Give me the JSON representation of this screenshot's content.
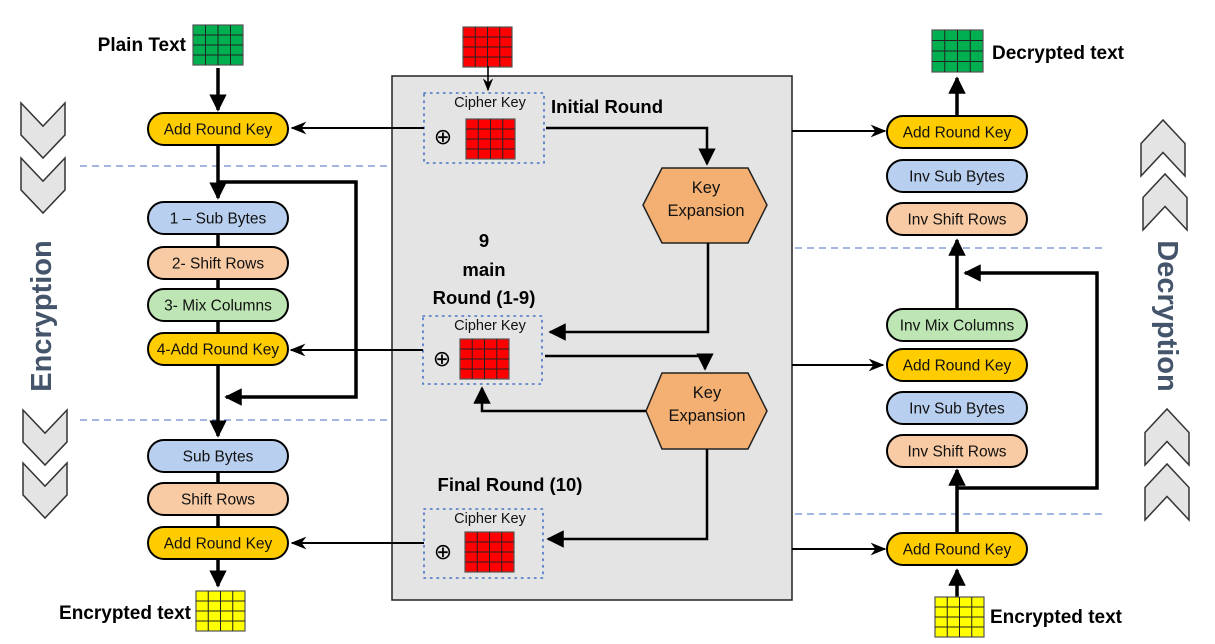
{
  "colors": {
    "yellow_pill": "#ffcc00",
    "blue_pill": "#b8cfef",
    "peach_pill": "#f8cba4",
    "green_pill": "#bde6b4",
    "key_expansion": "#f4b072",
    "round_panel": "#e4e4e4",
    "plain_block": "#00b050",
    "key_block": "#ff0000",
    "cipher_block": "#ffff00",
    "side_label": "#44546a",
    "divider": "#4472c4"
  },
  "side_labels": {
    "encryption": "Encryption",
    "decryption": "Decryption"
  },
  "encryption": {
    "input_label": "Plain Text",
    "output_label": "Encrypted text",
    "initial": {
      "add_round_key": "Add Round Key"
    },
    "main_steps": [
      "1 – Sub Bytes",
      "2- Shift Rows",
      "3- Mix Columns",
      "4-Add Round Key"
    ],
    "final_steps": [
      "Sub Bytes",
      "Shift Rows",
      "Add Round Key"
    ]
  },
  "key_schedule": {
    "initial_round_label": "Initial Round",
    "main_round_label_lines": [
      "9",
      "main",
      "Round (1-9)"
    ],
    "final_round_label": "Final Round (10)",
    "cipher_key_label": "Cipher Key",
    "xor_symbol": "⊕",
    "key_expansion_lines": [
      "Key",
      "Expansion"
    ]
  },
  "decryption": {
    "input_label": "Encrypted text",
    "output_label": "Decrypted text",
    "first_steps": [
      "Add Round Key"
    ],
    "main_steps": [
      "Inv Mix Columns",
      "Add Round Key",
      "Inv Sub Bytes",
      "Inv Shift Rows"
    ],
    "final_steps": [
      "Add Round Key",
      "Inv  Sub Bytes",
      "Inv Shift Rows"
    ]
  }
}
